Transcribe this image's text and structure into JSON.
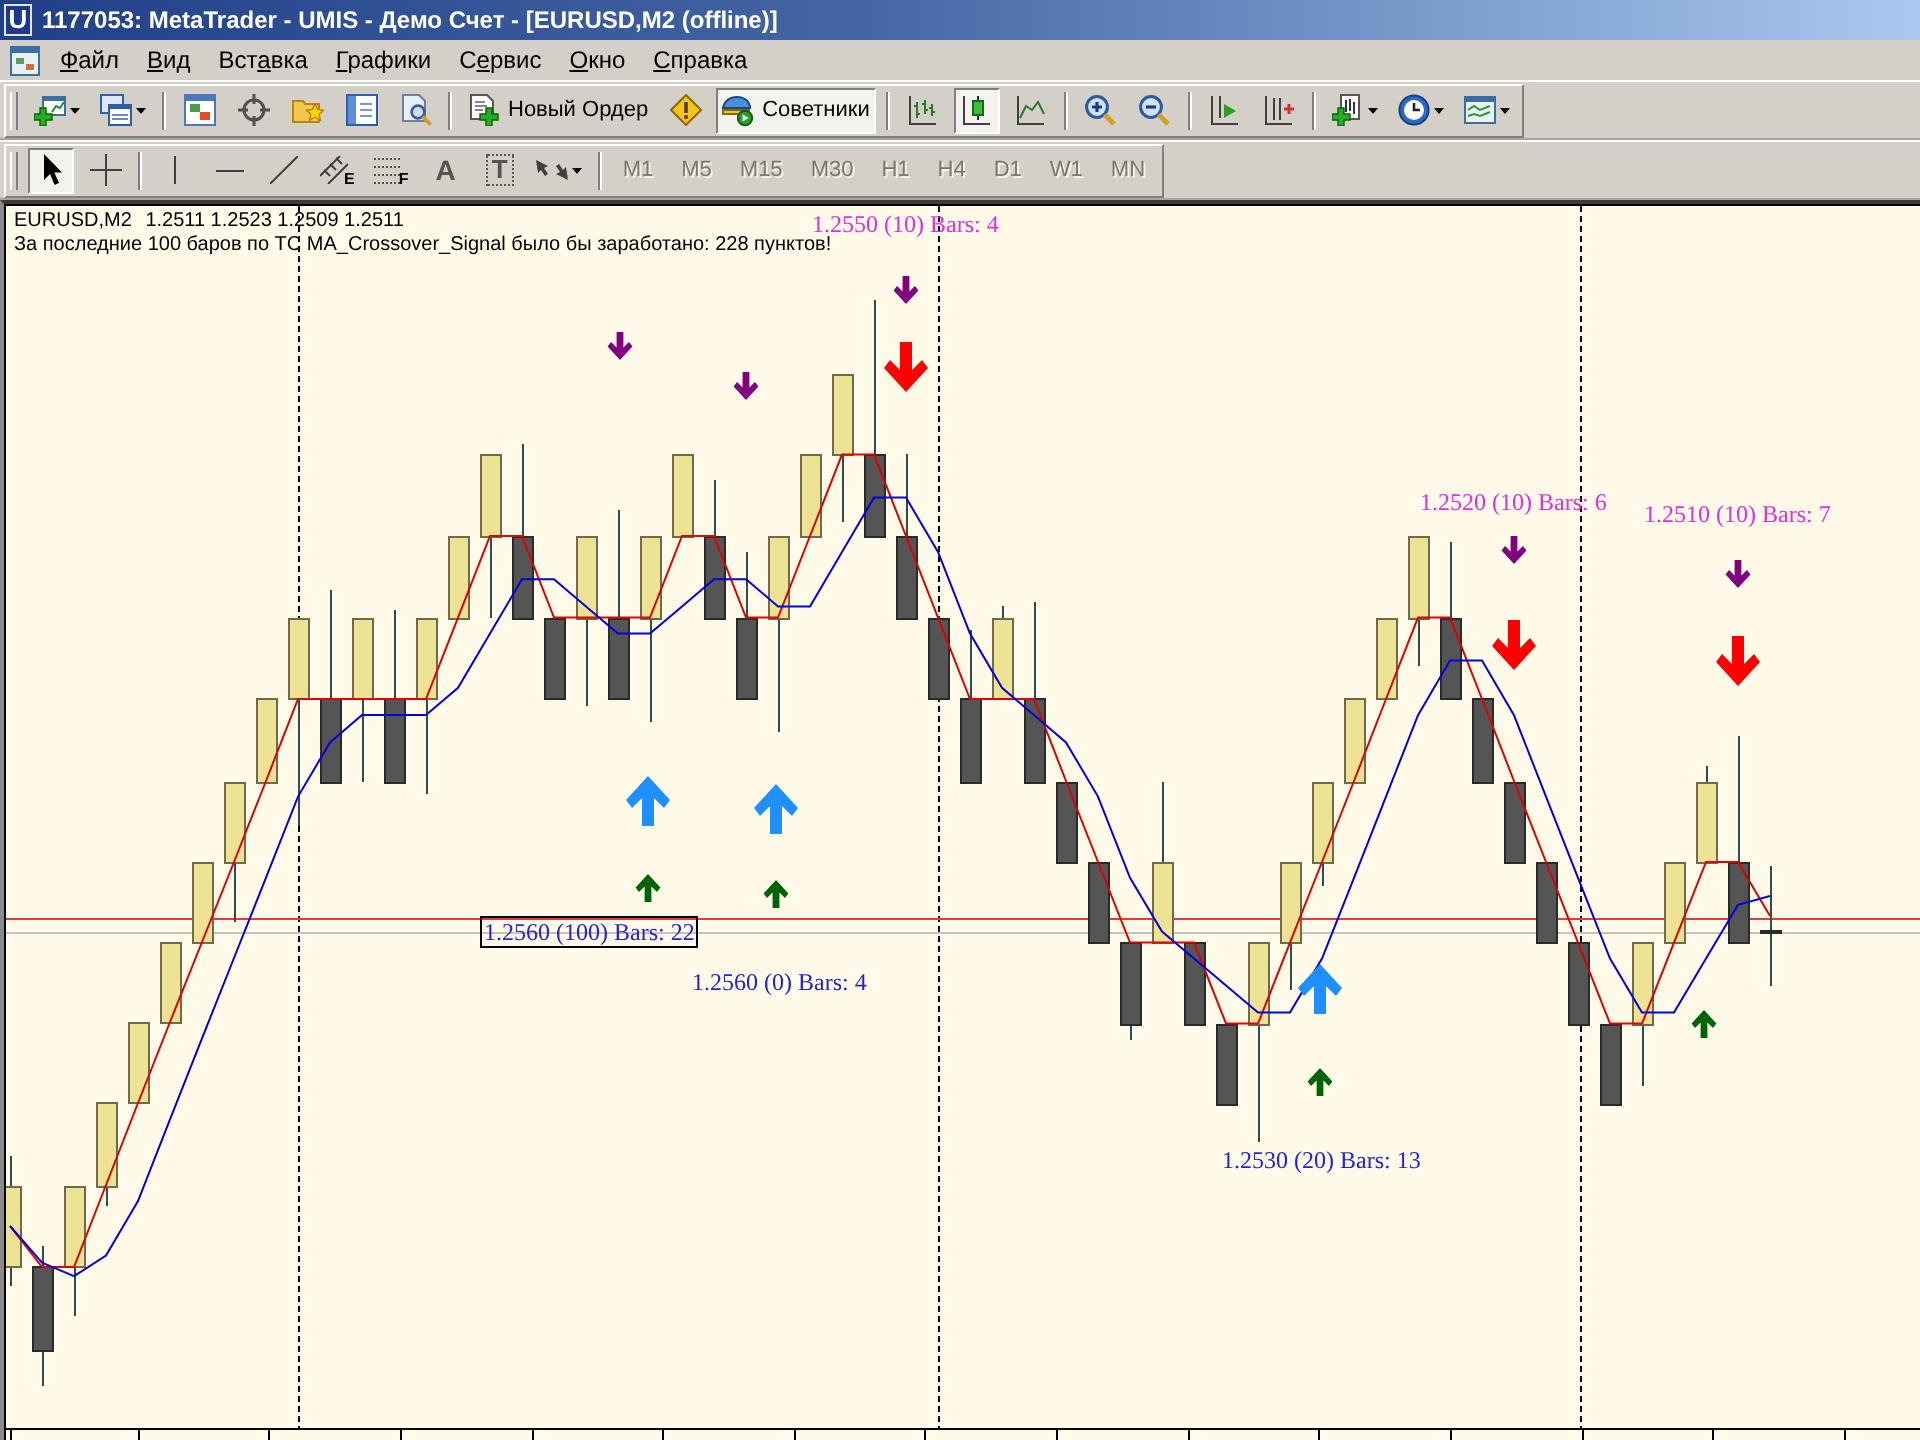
{
  "window": {
    "logo": "U",
    "title": "1177053: MetaTrader - UMIS - Демо Счет - [EURUSD,M2 (offline)]"
  },
  "menu": [
    {
      "key": "Ф",
      "after": "айл"
    },
    {
      "key": "В",
      "after": "ид"
    },
    {
      "before": "Вст",
      "key": "а",
      "after": "вка"
    },
    {
      "key": "Г",
      "after": "рафики"
    },
    {
      "before": "С",
      "key": "е",
      "after": "рвис"
    },
    {
      "key": "О",
      "after": "кно"
    },
    {
      "key": "С",
      "after": "правка"
    }
  ],
  "toolbar_main": {
    "groups": [
      [
        {
          "pressed": false,
          "dropdown": true
        },
        {
          "pressed": false,
          "dropdown": true
        }
      ],
      [
        {
          "pressed": false
        },
        {
          "pressed": false
        },
        {
          "pressed": false
        },
        {
          "pressed": false
        },
        {
          "pressed": false
        }
      ],
      [
        {
          "label": "Новый Ордер",
          "pressed": false
        },
        {
          "pressed": false
        },
        {
          "label": "Советники",
          "pressed": true
        }
      ],
      [
        {
          "pressed": false
        },
        {
          "pressed": true
        },
        {
          "pressed": false
        }
      ],
      [
        {
          "pressed": false
        },
        {
          "pressed": false
        }
      ],
      [
        {
          "pressed": false
        },
        {
          "pressed": false
        }
      ],
      [
        {
          "pressed": false,
          "dropdown": true
        },
        {
          "pressed": false,
          "dropdown": true
        },
        {
          "pressed": false,
          "dropdown": true
        }
      ]
    ]
  },
  "toolbar_tools": {
    "groups": [
      [
        {
          "pressed": true
        },
        {
          "pressed": false
        }
      ],
      [
        {
          "pressed": false
        },
        {
          "pressed": false
        },
        {
          "pressed": false
        },
        {
          "glyph": "E",
          "pressed": false
        },
        {
          "glyph": "F",
          "pressed": false
        },
        {
          "glyph": "A",
          "pressed": false
        },
        {
          "glyph": "T",
          "pressed": false
        },
        {
          "pressed": false,
          "dropdown": true
        }
      ],
      [
        {
          "label": "M1",
          "disabled": true
        },
        {
          "label": "M5",
          "disabled": true
        },
        {
          "label": "M15",
          "disabled": true
        },
        {
          "label": "M30",
          "disabled": true
        },
        {
          "label": "H1",
          "disabled": true
        },
        {
          "label": "H4",
          "disabled": true
        },
        {
          "label": "D1",
          "disabled": true
        },
        {
          "label": "W1",
          "disabled": true
        },
        {
          "label": "MN",
          "disabled": true
        }
      ]
    ]
  },
  "chart": {
    "symbol": "EURUSD,M2",
    "quotes": [
      "1.2511",
      "1.2523",
      "1.2509",
      "1.2511"
    ],
    "comment": "За последние 100 баров по ТС MA_Crossover_Signal было бы заработано: 228 пунктов!",
    "labels": [
      {
        "text": "1.2550 (10) Bars: 4",
        "color": "#e030e0",
        "selected": false
      },
      {
        "text": "1.2520 (10) Bars: 6",
        "color": "#e030e0",
        "selected": false
      },
      {
        "text": "1.2510 (10) Bars: 7",
        "color": "#e030e0",
        "selected": false
      },
      {
        "text": "1.2560 (100) Bars: 22",
        "color": "#2424d8",
        "selected": true
      },
      {
        "text": "1.2560 (0) Bars: 4",
        "color": "#2424d8",
        "selected": false
      },
      {
        "text": "1.2530 (20) Bars: 13",
        "color": "#2424d8",
        "selected": false
      }
    ]
  }
}
